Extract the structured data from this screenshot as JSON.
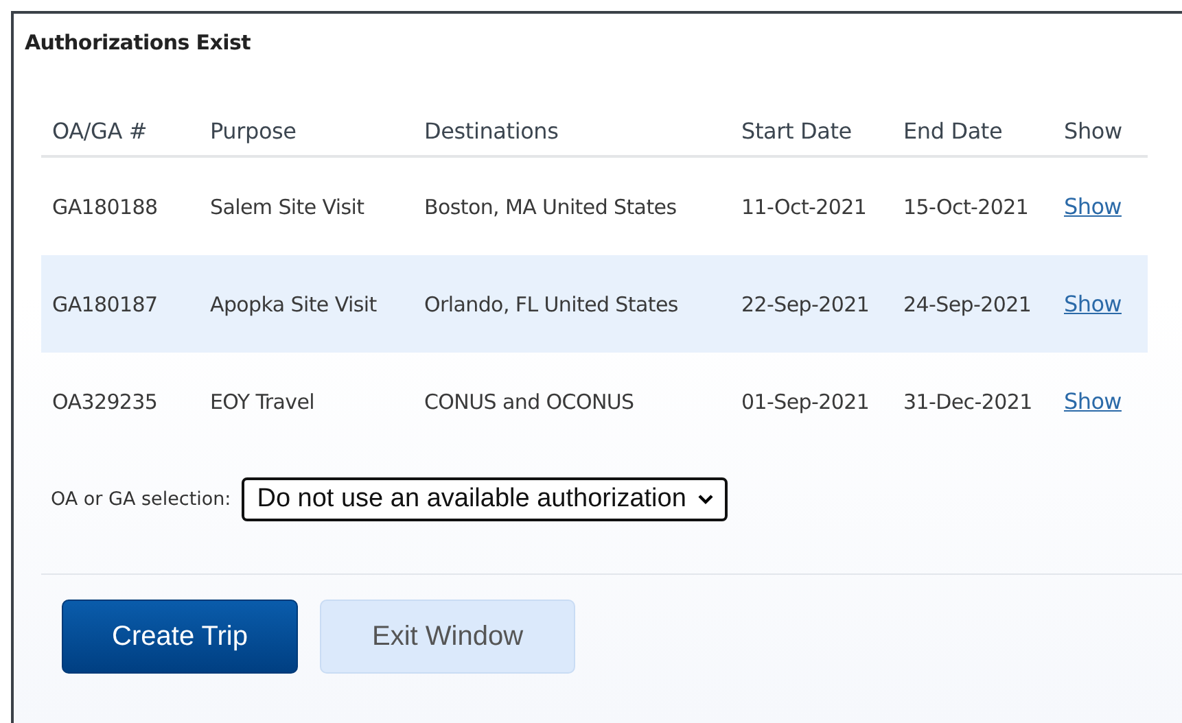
{
  "window": {
    "title": "Authorizations Exist"
  },
  "table": {
    "columns": [
      "OA/GA #",
      "Purpose",
      "Destinations",
      "Start Date",
      "End Date",
      "Show"
    ],
    "rows": [
      {
        "id": "GA180188",
        "purpose": "Salem Site Visit",
        "destinations": "Boston, MA United States",
        "start_date": "11-Oct-2021",
        "end_date": "15-Oct-2021",
        "show": "Show"
      },
      {
        "id": "GA180187",
        "purpose": "Apopka Site Visit",
        "destinations": "Orlando, FL United States",
        "start_date": "22-Sep-2021",
        "end_date": "24-Sep-2021",
        "show": "Show"
      },
      {
        "id": "OA329235",
        "purpose": "EOY Travel",
        "destinations": "CONUS and OCONUS",
        "start_date": "01-Sep-2021",
        "end_date": "31-Dec-2021",
        "show": "Show"
      }
    ]
  },
  "selection": {
    "label": "OA or GA selection:",
    "value": "Do not use an available authorization"
  },
  "buttons": [
    {
      "label": "Create Trip",
      "kind": "primary"
    },
    {
      "label": "Exit Window",
      "kind": "secondary"
    }
  ]
}
